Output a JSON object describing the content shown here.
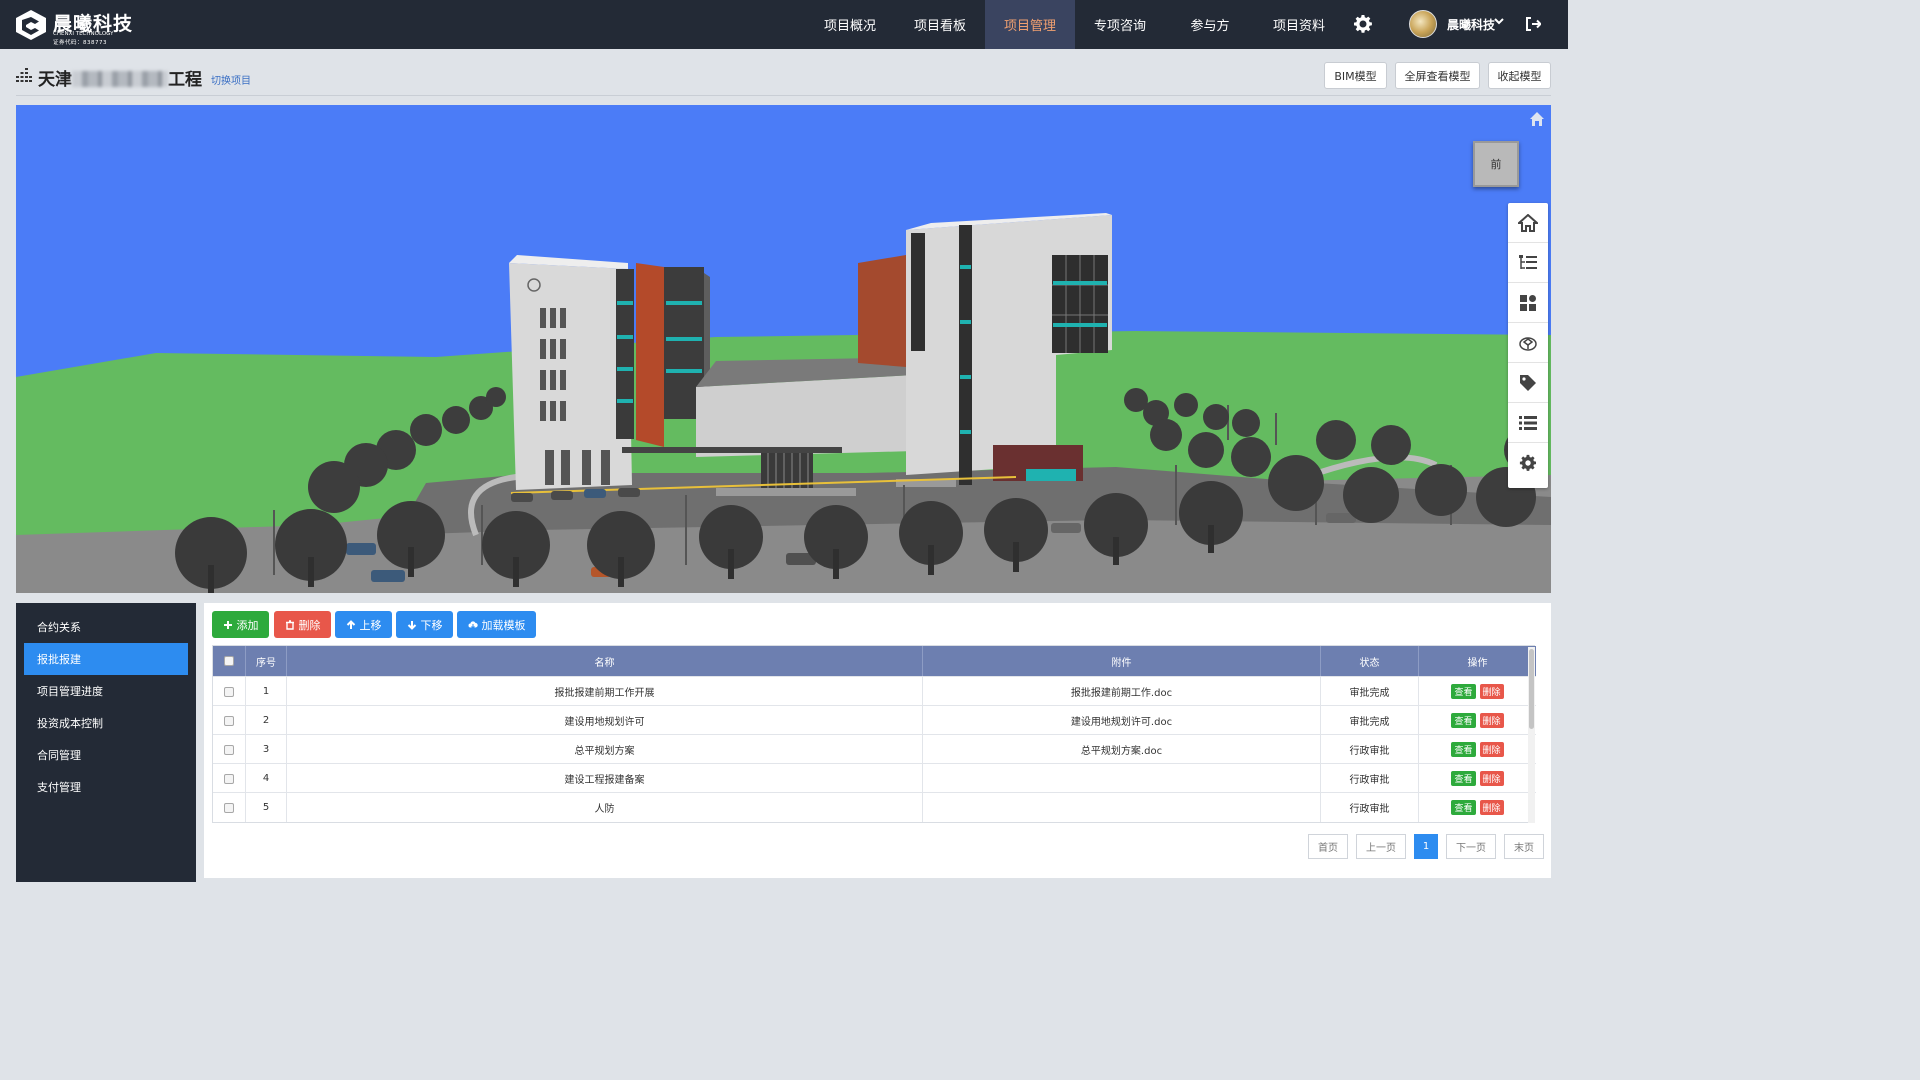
{
  "brand": {
    "name_cn": "晨曦科技",
    "name_en": "CHENXI TECHNOLOGY",
    "stock_code": "证券代码：838773"
  },
  "nav": {
    "items": [
      {
        "label": "项目概况",
        "active": false
      },
      {
        "label": "项目看板",
        "active": false
      },
      {
        "label": "项目管理",
        "active": true
      },
      {
        "label": "专项咨询",
        "active": false
      },
      {
        "label": "参与方",
        "active": false
      },
      {
        "label": "项目资料",
        "active": false
      }
    ],
    "settings_icon": "gear-icon",
    "user_name": "晨曦科技",
    "logout_icon": "logout-icon",
    "active_color": "#f0a070"
  },
  "project": {
    "title_prefix": "天津",
    "title_suffix": "工程",
    "switch_label": "切换项目",
    "buttons": {
      "bim": "BIM模型",
      "fullscreen": "全屏查看模型",
      "collapse": "收起模型"
    }
  },
  "viewer": {
    "viewcube_label": "前",
    "tools": [
      "home-icon",
      "model-tree-icon",
      "components-icon",
      "explode-icon",
      "tag-icon",
      "list-icon",
      "settings-icon"
    ]
  },
  "sidebar": {
    "items": [
      {
        "label": "合约关系",
        "active": false
      },
      {
        "label": "报批报建",
        "active": true
      },
      {
        "label": "项目管理进度",
        "active": false
      },
      {
        "label": "投资成本控制",
        "active": false
      },
      {
        "label": "合同管理",
        "active": false
      },
      {
        "label": "支付管理",
        "active": false
      }
    ]
  },
  "actions": {
    "add": "添加",
    "delete": "删除",
    "move_up": "上移",
    "move_down": "下移",
    "load_template": "加载模板"
  },
  "table": {
    "headers": {
      "index": "序号",
      "name": "名称",
      "attachment": "附件",
      "status": "状态",
      "ops": "操作"
    },
    "rows": [
      {
        "index": "1",
        "name": "报批报建前期工作开展",
        "attachment": "报批报建前期工作.doc",
        "status": "审批完成"
      },
      {
        "index": "2",
        "name": "建设用地规划许可",
        "attachment": "建设用地规划许可.doc",
        "status": "审批完成"
      },
      {
        "index": "3",
        "name": "总平规划方案",
        "attachment": "总平规划方案.doc",
        "status": "行政审批"
      },
      {
        "index": "4",
        "name": "建设工程报建备案",
        "attachment": "",
        "status": "行政审批"
      },
      {
        "index": "5",
        "name": "人防",
        "attachment": "",
        "status": "行政审批"
      }
    ],
    "view_label": "查看",
    "delete_label": "删除"
  },
  "pagination": {
    "first": "首页",
    "prev": "上一页",
    "current": "1",
    "next": "下一页",
    "last": "末页"
  },
  "colors": {
    "topbar": "#232a36",
    "accent_blue": "#2d8cf0",
    "success_green": "#2eaa3c",
    "danger_red": "#e8574a",
    "table_header": "#6d7fb0",
    "viewer_sky": "#4b7cf7"
  }
}
